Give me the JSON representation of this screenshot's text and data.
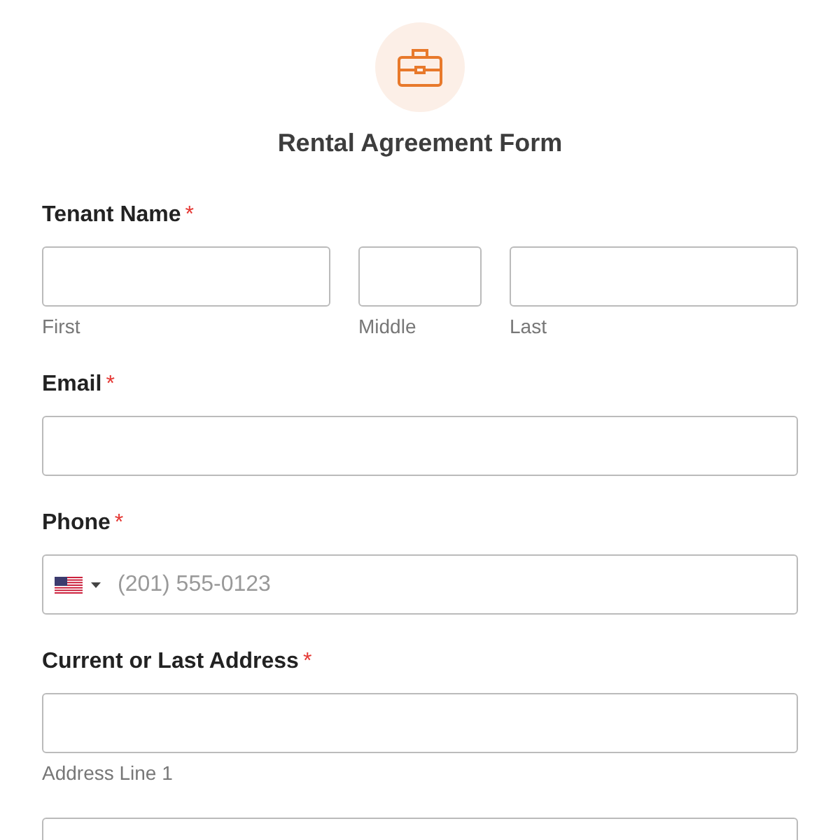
{
  "form": {
    "title": "Rental Agreement Form"
  },
  "sections": [
    {
      "kind": "name",
      "label": "Tenant Name",
      "required_mark": "*",
      "fields": [
        {
          "sublabel": "First"
        },
        {
          "sublabel": "Middle"
        },
        {
          "sublabel": "Last"
        }
      ]
    },
    {
      "kind": "text",
      "label": "Email",
      "required_mark": "*",
      "fields": [
        {
          "kind": "input"
        }
      ]
    },
    {
      "kind": "phone",
      "label": "Phone",
      "required_mark": "*",
      "fields": [
        {
          "placeholder": "(201) 555-0123"
        }
      ]
    },
    {
      "kind": "address",
      "label": "Current or Last Address",
      "required_mark": "*",
      "fields": [
        {
          "sublabel": "Address Line 1"
        },
        {
          "kind": "input"
        }
      ]
    }
  ]
}
